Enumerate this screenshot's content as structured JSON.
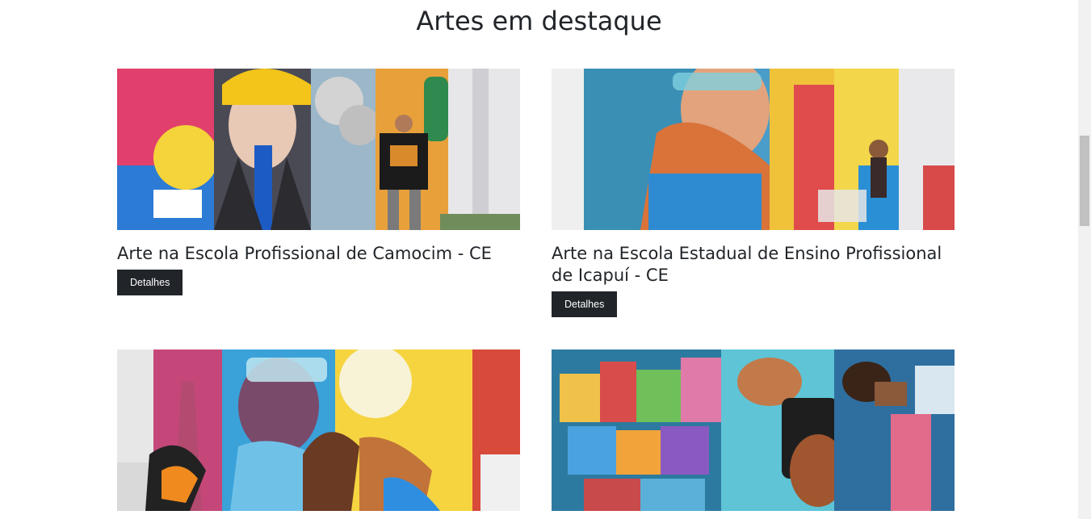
{
  "section": {
    "title": "Artes em destaque"
  },
  "cards": [
    {
      "title": "Arte na Escola Profissional de Camocim - CE",
      "button": "Detalhes"
    },
    {
      "title": "Arte na Escola Estadual de Ensino Profissional de Icapuí - CE",
      "button": "Detalhes"
    },
    {
      "title": "",
      "button": ""
    },
    {
      "title": "",
      "button": ""
    }
  ],
  "colors": {
    "button_bg": "#212529",
    "button_text": "#ffffff",
    "text": "#212529"
  }
}
